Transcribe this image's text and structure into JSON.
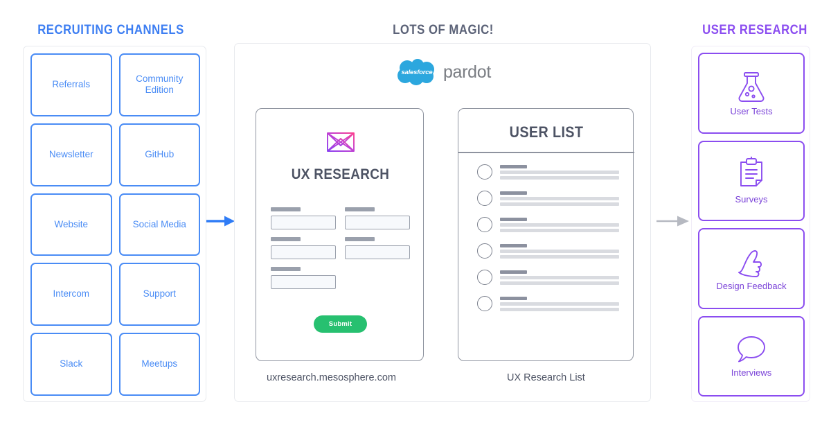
{
  "headings": {
    "left": "RECRUITING CHANNELS",
    "center": "LOTS OF MAGIC!",
    "right": "USER RESEARCH"
  },
  "colors": {
    "recruiting_accent": "#4a8cf5",
    "magic_accent": "#5c6378",
    "research_accent": "#8b4df0",
    "submit_green": "#27c070",
    "salesforce_blue": "#2ca7de",
    "arrow_left": "#2f7cf6",
    "arrow_right": "#b6b9c1"
  },
  "recruiting": {
    "channels": [
      {
        "label": "Referrals"
      },
      {
        "label": "Community Edition"
      },
      {
        "label": "Newsletter"
      },
      {
        "label": "GitHub"
      },
      {
        "label": "Website"
      },
      {
        "label": "Social Media"
      },
      {
        "label": "Intercom"
      },
      {
        "label": "Support"
      },
      {
        "label": "Slack"
      },
      {
        "label": "Meetups"
      }
    ]
  },
  "magic": {
    "logo": {
      "cloud_word": "salesforce",
      "product_word": "pardot",
      "icon": "salesforce-cloud-icon"
    },
    "form": {
      "brand_icon": "envelope-mark-icon",
      "title": "UX RESEARCH",
      "fields": [
        {
          "label_placeholder": "",
          "value": ""
        },
        {
          "label_placeholder": "",
          "value": ""
        },
        {
          "label_placeholder": "",
          "value": ""
        },
        {
          "label_placeholder": "",
          "value": ""
        },
        {
          "label_placeholder": "",
          "value": ""
        }
      ],
      "submit_label": "Submit",
      "caption": "uxresearch.mesosphere.com"
    },
    "user_list": {
      "title": "USER LIST",
      "rows": [
        {
          "avatar": "user-avatar-icon"
        },
        {
          "avatar": "user-avatar-icon"
        },
        {
          "avatar": "user-avatar-icon"
        },
        {
          "avatar": "user-avatar-icon"
        },
        {
          "avatar": "user-avatar-icon"
        },
        {
          "avatar": "user-avatar-icon"
        }
      ],
      "caption": "UX Research List"
    }
  },
  "research": {
    "items": [
      {
        "label": "User Tests",
        "icon": "flask-icon"
      },
      {
        "label": "Surveys",
        "icon": "clipboard-icon"
      },
      {
        "label": "Design Feedback",
        "icon": "thumbs-up-icon"
      },
      {
        "label": "Interviews",
        "icon": "speech-bubble-icon"
      }
    ]
  },
  "flow": {
    "arrow_left": "arrow-right-icon",
    "arrow_right": "arrow-right-icon"
  }
}
